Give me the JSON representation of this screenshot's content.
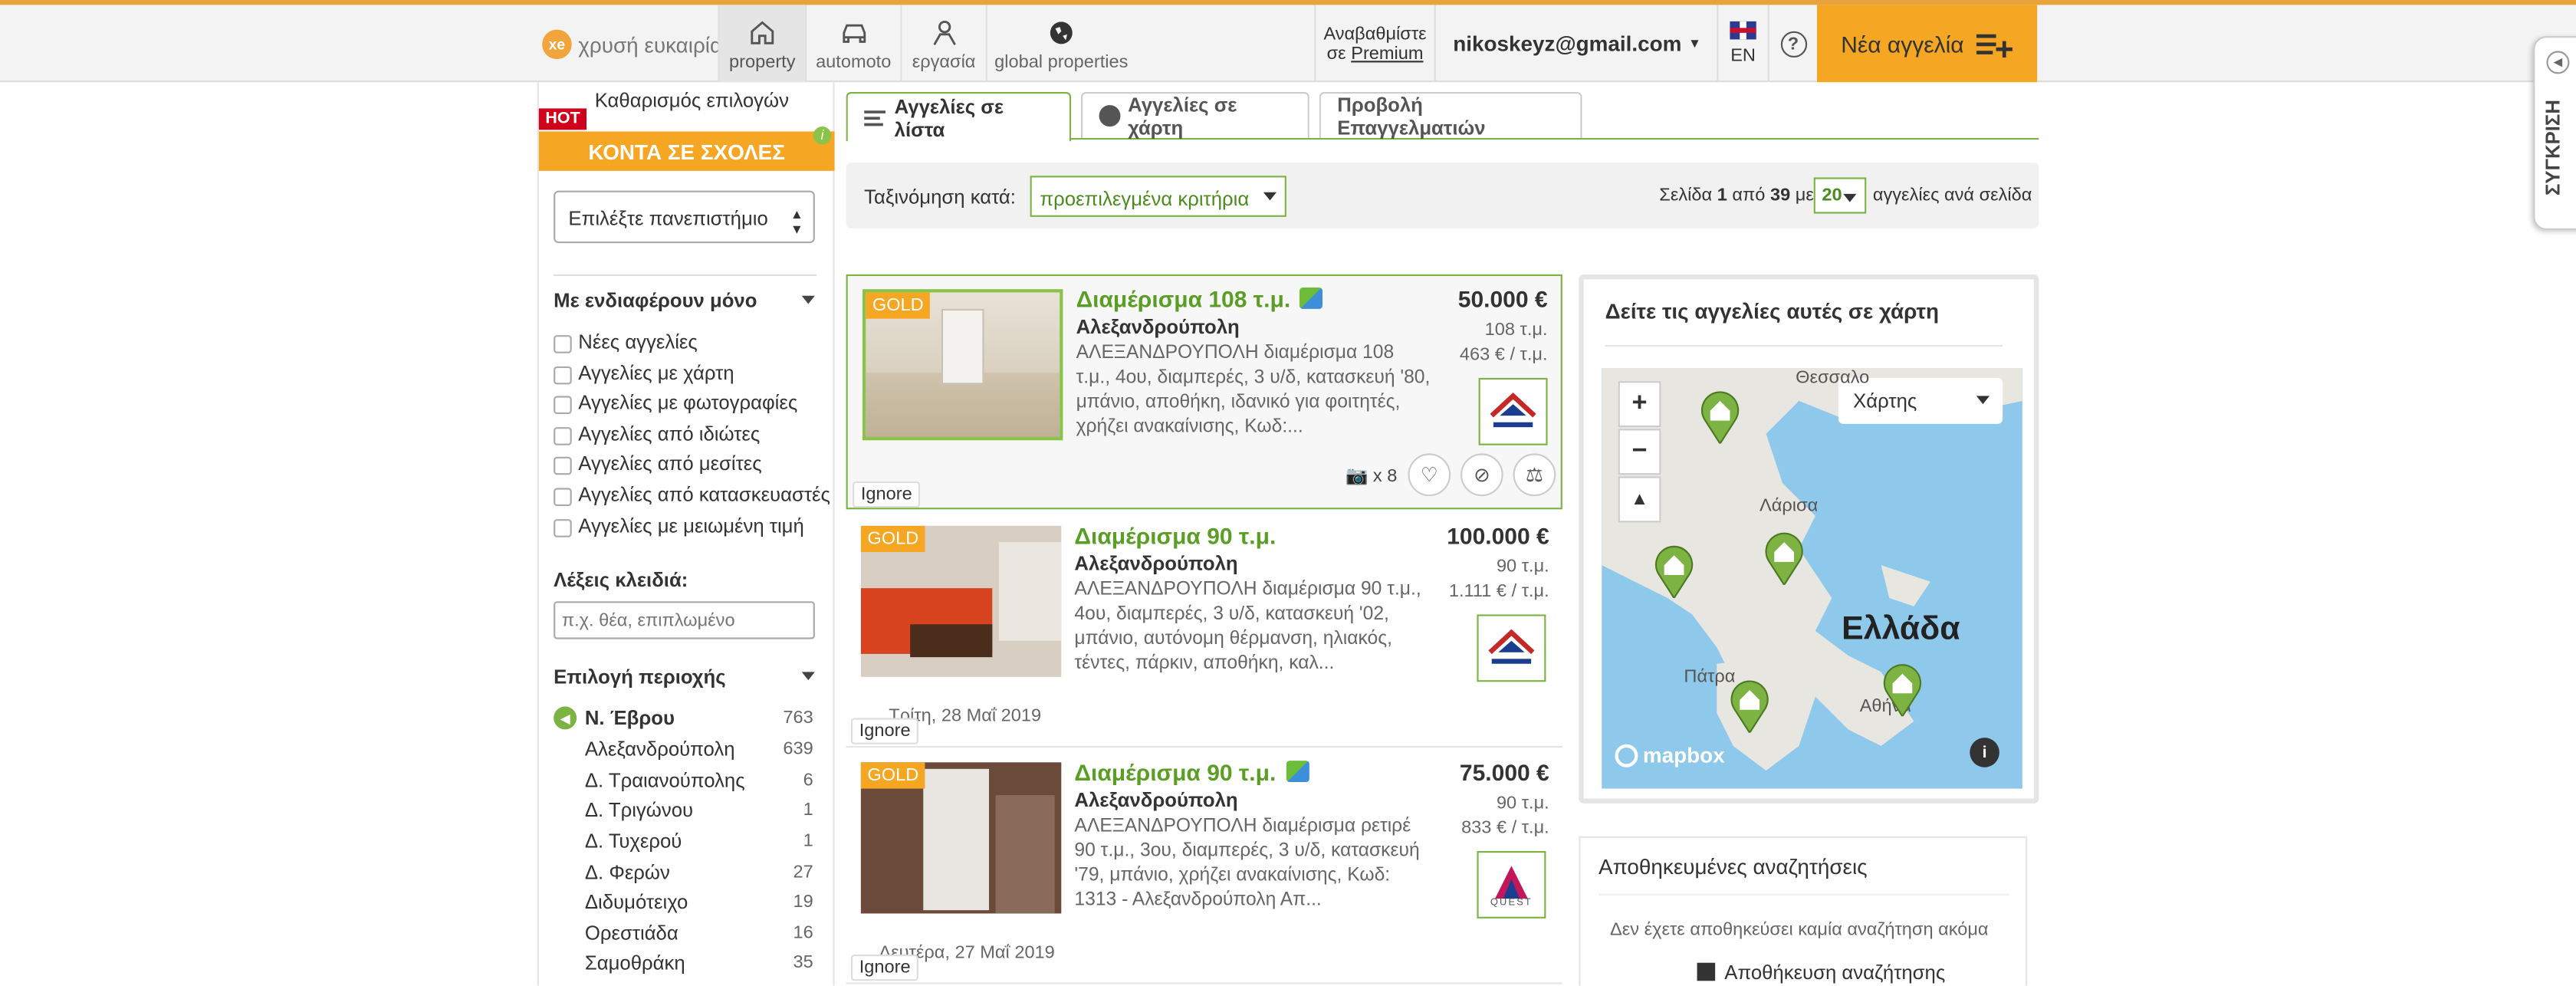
{
  "header": {
    "logo_text": "χρυσή ευκαιρία",
    "logo_badge": "xe",
    "nav": [
      {
        "label": "property"
      },
      {
        "label": "automoto"
      },
      {
        "label": "εργασία"
      },
      {
        "label": "global properties"
      }
    ],
    "upgrade_line1": "Αναβαθμίστε",
    "upgrade_prefix": "σε",
    "upgrade_link": "Premium",
    "email": "nikoskeyz@gmail.com",
    "lang": "EN",
    "new_ad": "Νέα αγγελία"
  },
  "compare": {
    "label": "ΣΥΓΚΡΙΣΗ"
  },
  "sidebar": {
    "clear": "Καθαρισμός επιλογών",
    "hot": "HOT",
    "schools": "ΚΟΝΤΑ ΣΕ ΣΧΟΛΕΣ",
    "university_select": "Επιλέξτε πανεπιστήμιο",
    "interest_title": "Με ενδιαφέρουν μόνο",
    "filters": [
      "Νέες αγγελίες",
      "Αγγελίες με χάρτη",
      "Αγγελίες με φωτογραφίες",
      "Αγγελίες από ιδιώτες",
      "Αγγελίες από μεσίτες",
      "Αγγελίες από κατασκευαστές",
      "Αγγελίες με μειωμένη τιμή"
    ],
    "keywords_title": "Λέξεις κλειδιά:",
    "keywords_placeholder": "π.χ. θέα, επιπλωμένο",
    "region_title": "Επιλογή περιοχής",
    "region_parent": {
      "name": "Ν. Έβρου",
      "count": "763"
    },
    "regions": [
      {
        "name": "Αλεξανδρούπολη",
        "count": "639"
      },
      {
        "name": "Δ. Τραιανούπολης",
        "count": "6"
      },
      {
        "name": "Δ. Τριγώνου",
        "count": "1"
      },
      {
        "name": "Δ. Τυχερού",
        "count": "1"
      },
      {
        "name": "Δ. Φερών",
        "count": "27"
      },
      {
        "name": "Διδυμότειχο",
        "count": "19"
      },
      {
        "name": "Ορεστιάδα",
        "count": "16"
      },
      {
        "name": "Σαμοθράκη",
        "count": "35"
      }
    ]
  },
  "tabs": [
    {
      "label": "Αγγελίες σε λίστα"
    },
    {
      "label": "Αγγελίες σε χάρτη"
    },
    {
      "label": "Προβολή Επαγγελματιών"
    }
  ],
  "sort": {
    "label": "Ταξινόμηση κατά:",
    "value": "προεπιλεγμένα κριτήρια",
    "page_prefix": "Σελίδα",
    "page": "1",
    "of": "από",
    "pages": "39",
    "with": "με",
    "per_page": "20",
    "per_page_suffix": "αγγελίες ανά σελίδα"
  },
  "listings": [
    {
      "badge": "GOLD",
      "title": "Διαμέρισμα 108 τ.μ.",
      "location": "Αλεξανδρούπολη",
      "description": "ΑΛΕΞΑΝΔΡΟΥΠΟΛΗ διαμέρισμα 108 τ.μ., 4ου, διαμπερές, 3 υ/δ, κατασκευή '80, μπάνιο, αποθήκη, ιδανικό για φοιτητές, χρήζει ανακαίνισης, Κωδ:...",
      "price": "50.000 €",
      "area": "108 τ.μ.",
      "price_per_sqm": "463 € / τ.μ.",
      "photos": "x 8",
      "ignore": "Ignore",
      "date": ""
    },
    {
      "badge": "GOLD",
      "title": "Διαμέρισμα 90 τ.μ.",
      "location": "Αλεξανδρούπολη",
      "description": "ΑΛΕΞΑΝΔΡΟΥΠΟΛΗ διαμέρισμα 90 τ.μ., 4ου, διαμπερές, 3 υ/δ, κατασκευή '02, μπάνιο, αυτόνομη θέρμανση, ηλιακός, τέντες, πάρκιν, αποθήκη, καλ...",
      "price": "100.000 €",
      "area": "90 τ.μ.",
      "price_per_sqm": "1.111 € / τ.μ.",
      "ignore": "Ignore",
      "date": "Τρίτη, 28 Μαΐ 2019"
    },
    {
      "badge": "GOLD",
      "title": "Διαμέρισμα 90 τ.μ.",
      "location": "Αλεξανδρούπολη",
      "description": "ΑΛΕΞΑΝΔΡΟΥΠΟΛΗ διαμέρισμα ρετιρέ 90 τ.μ., 3ου, διαμπερές, 3 υ/δ, κατασκευή '79, μπάνιο, χρήζει ανακαίνισης, Κωδ: 1313 - Αλεξανδρούπολη Απ...",
      "price": "75.000 €",
      "area": "90 τ.μ.",
      "price_per_sqm": "833 € / τ.μ.",
      "ignore": "Ignore",
      "date": "Δευτέρα, 27 Μαΐ 2019",
      "agent_text": "QUEST"
    }
  ],
  "map_panel": {
    "title": "Δείτε τις αγγελίες αυτές σε χάρτη",
    "type_select": "Χάρτης",
    "label_country": "Ελλάδα",
    "label_thessaloniki": "Θεσσαλο",
    "label_larisa": "Λάρισα",
    "label_patra": "Πάτρα",
    "label_athens": "Αθήνα",
    "attribution": "mapbox"
  },
  "saved": {
    "title": "Αποθηκευμένες αναζητήσεις",
    "none": "Δεν έχετε αποθηκεύσει καμία αναζήτηση ακόμα",
    "save_button": "Αποθήκευση αναζήτησης"
  },
  "colors": {
    "accent_orange": "#f5a623",
    "accent_green": "#5a9e25",
    "hot_red": "#d0021b"
  }
}
